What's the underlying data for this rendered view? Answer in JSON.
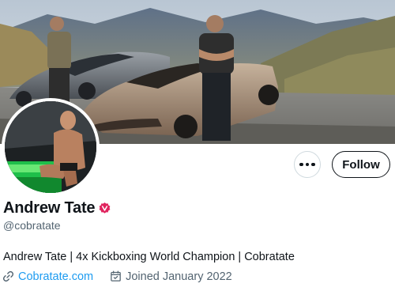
{
  "profile": {
    "display_name": "Andrew Tate",
    "handle": "@cobratate",
    "bio": "Andrew Tate | 4x Kickboxing World Champion | Cobratate",
    "website": "Cobratate.com",
    "joined": "Joined January 2022",
    "verified": true,
    "verified_badge_color": "#e0245e"
  },
  "actions": {
    "more_icon": "more-horizontal-icon",
    "follow_label": "Follow"
  },
  "icons": {
    "website": "link-icon",
    "joined": "calendar-icon"
  },
  "colors": {
    "link": "#1d9bf0",
    "secondary_text": "#536471",
    "primary_text": "#0f1419"
  }
}
